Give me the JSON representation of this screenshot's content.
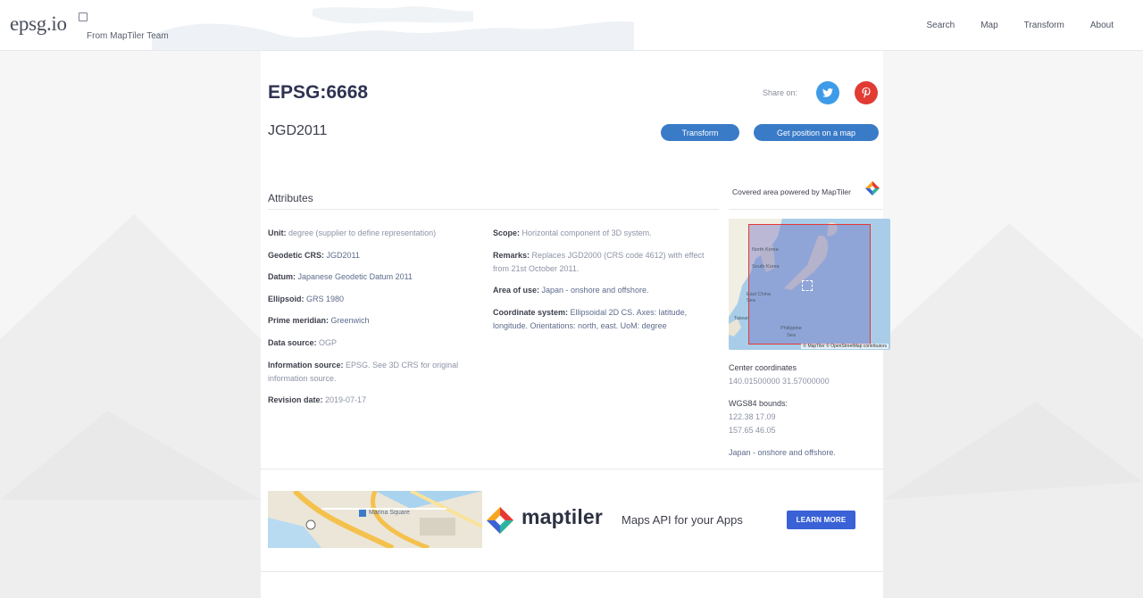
{
  "header": {
    "logo": "epsg.io",
    "logo_sub": "From MapTiler Team",
    "nav": [
      {
        "label": "Search"
      },
      {
        "label": "Map"
      },
      {
        "label": "Transform"
      },
      {
        "label": "About"
      }
    ]
  },
  "crs": {
    "code": "EPSG:6668",
    "name": "JGD2011"
  },
  "share": {
    "label": "Share on:",
    "twitter_icon": "twitter-icon",
    "pinterest_icon": "pinterest-icon"
  },
  "actions": {
    "transform": "Transform",
    "map": "Get position on a map"
  },
  "attributes": {
    "title": "Attributes",
    "unit": {
      "label": "Unit:",
      "value": "degree (supplier to define representation)"
    },
    "geodetic_crs": {
      "label": "Geodetic CRS:",
      "value": "JGD2011"
    },
    "datum": {
      "label": "Datum:",
      "value": "Japanese Geodetic Datum 2011"
    },
    "ellipsoid": {
      "label": "Ellipsoid:",
      "value": "GRS 1980"
    },
    "prime_meridian": {
      "label": "Prime meridian:",
      "value": "Greenwich"
    },
    "data_source": {
      "label": "Data source:",
      "value": "OGP"
    },
    "information_source": {
      "label": "Information source:",
      "value": "EPSG. See 3D CRS for original information source."
    },
    "revision_date": {
      "label": "Revision date:",
      "value": "2019-07-17"
    },
    "scope": {
      "label": "Scope:",
      "value": "Horizontal component of 3D system."
    },
    "remarks": {
      "label": "Remarks:",
      "value": "Replaces JGD2000 (CRS code 4612) with effect from 21st October 2011."
    },
    "area_of_use": {
      "label": "Area of use:",
      "value": "Japan - onshore and offshore."
    },
    "coordinate_system": {
      "label": "Coordinate system:",
      "value": "Ellipsoidal 2D CS. Axes: latitude, longitude. Orientations: north, east. UoM: degree"
    }
  },
  "coverage": {
    "label": "Covered area powered by MapTiler",
    "map_labels": {
      "north_korea": "North Korea",
      "south_korea": "South Korea",
      "east_china_sea": "East China Sea",
      "taiwan": "Taiwan",
      "philippine_sea": "Philippine Sea"
    },
    "attribution": "© MapTiler © OpenStreetMap contributors",
    "center_label": "Center coordinates",
    "center_value": "140.01500000 31.57000000",
    "bounds_label": "WGS84 bounds:",
    "bounds_line1": "122.38 17.09",
    "bounds_line2": "157.65 46.05",
    "area_text": "Japan - onshore and offshore."
  },
  "ad": {
    "brand": "maptiler",
    "tagline": "Maps API for your Apps",
    "cta": "LEARN MORE",
    "map_label": "Marina Square"
  },
  "colors": {
    "accent": "#3a7bc8",
    "twitter": "#3e9be8",
    "pinterest": "#e23b33",
    "ad_button": "#3a62d6",
    "coverage_box": "#e53935"
  }
}
